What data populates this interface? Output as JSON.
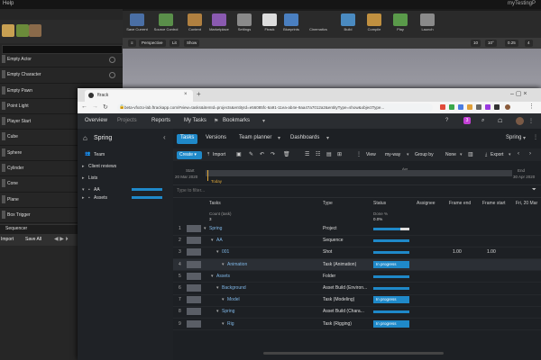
{
  "ue": {
    "menu_help": "Help",
    "project_name": "myTestingP",
    "place_items": [
      "Empty Actor",
      "Empty Character",
      "Empty Pawn",
      "Point Light",
      "Player Start",
      "Cube",
      "Sphere",
      "Cylinder",
      "Cone",
      "Plane",
      "Box Trigger"
    ],
    "sequencer_tab": "Sequencer",
    "sequencer_import": "Import",
    "sequencer_save_all": "Save All",
    "toolbar": [
      "Save Current",
      "Source Control",
      "Content",
      "Marketplace",
      "Settings",
      "Ftrack",
      "Blueprints",
      "Cinematics",
      "Build",
      "Compile",
      "Play",
      "Launch"
    ],
    "viewport_buttons": [
      "Perspective",
      "Lit",
      "Show"
    ],
    "viewport_values": [
      "10",
      "10°",
      "0.25",
      "4"
    ],
    "colors": {
      "accent": "#1f89c9",
      "viewport": "#c3c3c9"
    }
  },
  "browser": {
    "tab_title": "ftrack",
    "url": "beta-vfxcto-lab.ftrackapp.com/#view=tasks&itemId=projects&entityId=e56085fc-6a91-11ea-ab4e-9aa47a7012a2&entityType=show&objectType..."
  },
  "ftrack": {
    "topnav": [
      "Overview",
      "Projects",
      "Reports",
      "My Tasks",
      "Bookmarks"
    ],
    "notif_count": "3",
    "sidebar_title": "Spring",
    "sidebar": {
      "team": "Team",
      "client_reviews": "Client reviews",
      "lists": "Lists",
      "tree": [
        "AA",
        "Assets"
      ]
    },
    "project_tabs": [
      "Tasks",
      "Versions",
      "Team planner",
      "Dashboards"
    ],
    "project_name": "Spring",
    "toolbar": {
      "create": "Create",
      "import": "Import",
      "view": "View",
      "view_value": "my-way",
      "group_by": "Group by",
      "group_value": "None",
      "export": "Export"
    },
    "timeline": {
      "start_label": "Start",
      "start_date": "20 Mar 2020",
      "today": "Today",
      "end_label": "End",
      "end_date": "30 Apr 2020",
      "month": "Apr"
    },
    "filter_placeholder": "Type to filter...",
    "columns": [
      "Tasks",
      "Type",
      "Status",
      "Assignee",
      "Frame end",
      "Frame start",
      "Fri, 20 Mar"
    ],
    "count_label": "Count (task)",
    "count_value": "3",
    "done_label": "Done %",
    "done_value": "0.0%",
    "rows": [
      {
        "num": "1",
        "name": "Spring",
        "type": "Project",
        "status": "",
        "fe": "",
        "fs": "",
        "progress": 0.75
      },
      {
        "num": "2",
        "name": "AA",
        "type": "Sequence",
        "status": "",
        "fe": "",
        "fs": "",
        "progress": 1.0
      },
      {
        "num": "3",
        "name": "001",
        "type": "Shot",
        "status": "",
        "fe": "1.00",
        "fs": "1.00",
        "progress": 1.0
      },
      {
        "num": "4",
        "name": "Animation",
        "type": "Task (Animation)",
        "status": "In progress",
        "fe": "",
        "fs": "",
        "progress": null
      },
      {
        "num": "5",
        "name": "Assets",
        "type": "Folder",
        "status": "",
        "fe": "",
        "fs": "",
        "progress": 1.0
      },
      {
        "num": "6",
        "name": "Background",
        "type": "Asset Build (Environ...",
        "status": "",
        "fe": "",
        "fs": "",
        "progress": 1.0
      },
      {
        "num": "7",
        "name": "Model",
        "type": "Task (Modeling)",
        "status": "In progress",
        "fe": "",
        "fs": "",
        "progress": null
      },
      {
        "num": "8",
        "name": "Spring",
        "type": "Asset Build (Chara...",
        "status": "",
        "fe": "",
        "fs": "",
        "progress": 1.0
      },
      {
        "num": "9",
        "name": "Rig",
        "type": "Task (Rigging)",
        "status": "In progress",
        "fe": "",
        "fs": "",
        "progress": null
      }
    ]
  }
}
